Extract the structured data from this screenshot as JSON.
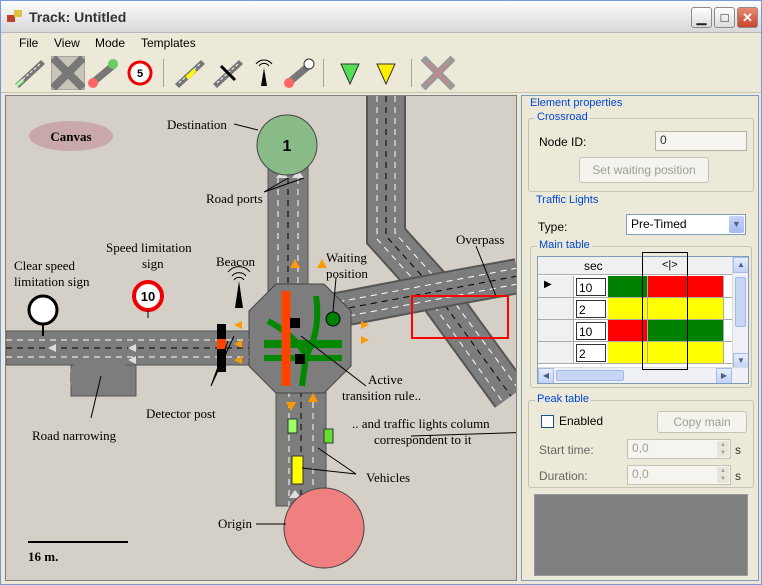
{
  "window": {
    "title": "Track: Untitled"
  },
  "menu": [
    "File",
    "View",
    "Mode",
    "Templates"
  ],
  "toolbar": {
    "icons": [
      "road-tool-icon",
      "crossroad-tool-icon",
      "connection-tool-icon",
      "speed-limit-tool-icon",
      "lane-marking-tool-icon",
      "detector-tool-icon",
      "beacon-tool-icon",
      "path-tool-icon",
      "origin-tool-icon",
      "destination-tool-icon",
      "delete-tool-icon"
    ],
    "speed_sign_value": "5"
  },
  "canvas": {
    "label": "Canvas",
    "destination_number": "1",
    "speed_sign_value": "10",
    "scale_label": "16 m.",
    "annotations": {
      "destination": "Destination",
      "road_ports": "Road ports",
      "clear_speed_1": "Clear speed",
      "clear_speed_2": "limitation sign",
      "speed_limit_1": "Speed limitation",
      "speed_limit_2": "sign",
      "beacon": "Beacon",
      "waiting_1": "Waiting",
      "waiting_2": "position",
      "overpass": "Overpass",
      "active_1": "Active",
      "active_2": "transition rule..",
      "detector": "Detector post",
      "road_narrowing": "Road narrowing",
      "tl_column_1": ".. and traffic lights column",
      "tl_column_2": "correspondent to it",
      "vehicles": "Vehicles",
      "origin": "Origin"
    }
  },
  "panel": {
    "title": "Element properties",
    "crossroad": {
      "title": "Crossroad",
      "node_id_label": "Node ID:",
      "node_id_value": "0",
      "set_waiting_button": "Set waiting position"
    },
    "traffic_lights": {
      "title": "Traffic Lights",
      "type_label": "Type:",
      "type_value": "Pre-Timed",
      "main_table_title": "Main table",
      "columns": {
        "sec": "sec",
        "lights": "<|>"
      },
      "rows": [
        {
          "sec": "10",
          "cells": [
            "green",
            "red",
            "red"
          ]
        },
        {
          "sec": "2",
          "cells": [
            "yellow",
            "yellow",
            "yellow"
          ]
        },
        {
          "sec": "10",
          "cells": [
            "red",
            "green",
            "green"
          ]
        },
        {
          "sec": "2",
          "cells": [
            "yellow",
            "yellow",
            "yellow"
          ]
        }
      ]
    },
    "peak_table": {
      "title": "Peak table",
      "enabled_label": "Enabled",
      "enabled": false,
      "copy_main_button": "Copy main",
      "start_time_label": "Start time:",
      "start_time_value": "0,0",
      "duration_label": "Duration:",
      "duration_value": "0,0",
      "unit": "s"
    }
  },
  "colors": {
    "green": "#008000",
    "red": "#ff0000",
    "yellow": "#ffff00",
    "road": "#7d7d7d"
  }
}
